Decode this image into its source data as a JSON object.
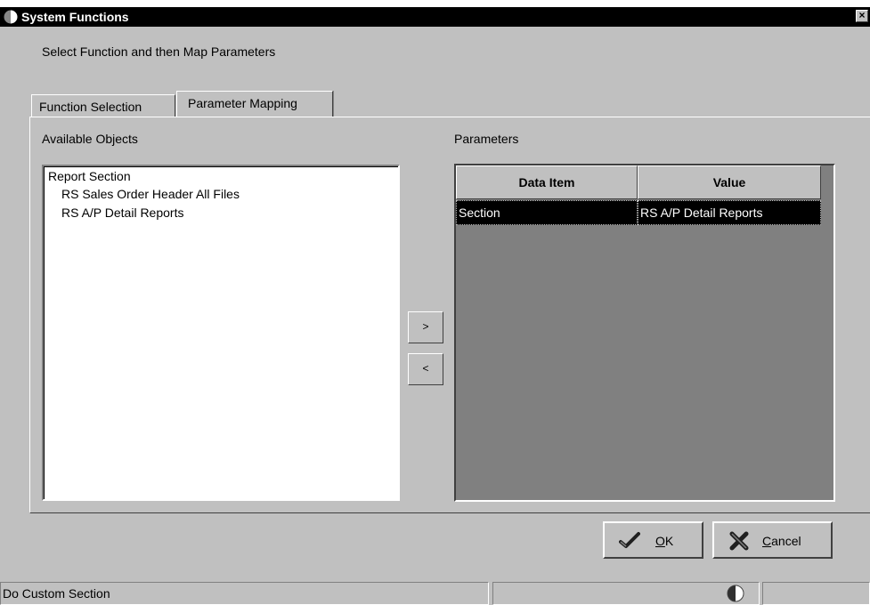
{
  "window": {
    "title": "System Functions",
    "close_glyph": "×"
  },
  "instruction": "Select Function and then Map Parameters",
  "tabs": [
    {
      "label": "Function Selection",
      "active": false
    },
    {
      "label": "Parameter Mapping",
      "active": true
    }
  ],
  "available_objects": {
    "label": "Available Objects",
    "items": [
      {
        "text": "Report Section",
        "level": 0
      },
      {
        "text": "RS Sales Order Header All Files",
        "level": 1
      },
      {
        "text": "RS A/P Detail Reports",
        "level": 1
      }
    ]
  },
  "move_buttons": {
    "add": ">",
    "remove": "<"
  },
  "parameters": {
    "label": "Parameters",
    "columns": [
      "Data Item",
      "Value"
    ],
    "rows": [
      {
        "data_item": "Section",
        "value": "RS A/P Detail Reports",
        "selected": true
      }
    ]
  },
  "actions": {
    "ok": {
      "label": "OK",
      "accel": "O",
      "icon": "checkmark-icon"
    },
    "cancel": {
      "label": "Cancel",
      "accel": "C",
      "icon": "x-cancel-icon"
    }
  },
  "status_bar": {
    "text": "Do Custom Section",
    "icon": "globe-icon"
  },
  "colors": {
    "face": "#c0c0c0",
    "grid_bg": "#808080",
    "selection": "#000000",
    "titlebar": "#000000"
  }
}
